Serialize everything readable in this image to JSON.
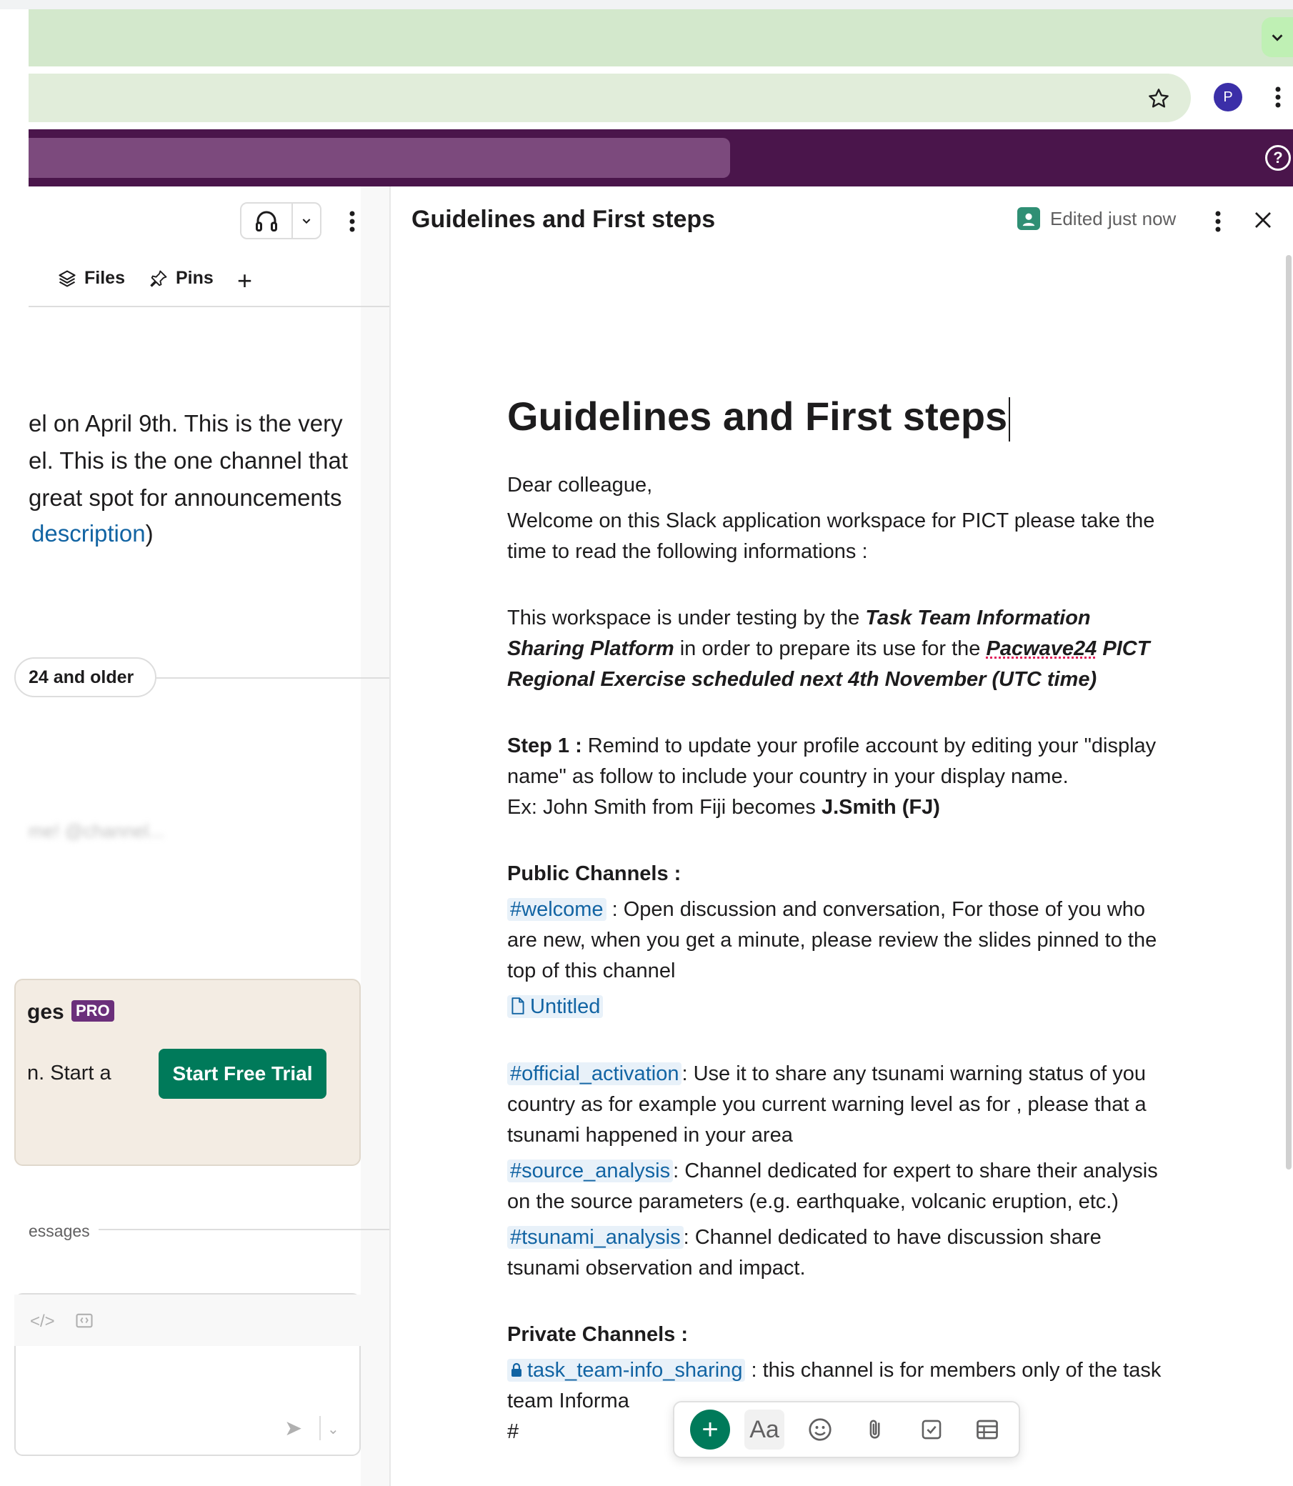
{
  "browser": {
    "profile_initial": "P"
  },
  "left": {
    "tabs": {
      "files": "Files",
      "pins": "Pins"
    },
    "intro_lines": [
      "el on April 9th. This is the very",
      "el. This is the one channel that",
      "great spot for announcements"
    ],
    "intro_link": "description",
    "intro_link_after": ")",
    "date_pill": "24 and older",
    "blurred_text": "me! @channel...",
    "upsell": {
      "title": "ges",
      "badge": "PRO",
      "text": "n. Start a",
      "button": "Start Free Trial"
    },
    "messages_divider": "essages"
  },
  "canvas": {
    "header_title": "Guidelines and First steps",
    "status": "Edited just now",
    "title": "Guidelines and First steps",
    "greeting": "Dear colleague,",
    "welcome": "Welcome on this Slack application workspace for PICT please take the time to read the following informations :",
    "testing_pre": "This workspace is under testing by the ",
    "testing_bold": "Task Team Information Sharing Platform",
    "testing_mid": " in order to prepare its use for the ",
    "testing_spell": "Pacwave24",
    "testing_bold2": " PICT Regional Exercise scheduled next 4th November (UTC time)",
    "step1_label": "Step 1 :",
    "step1_text": " Remind to update your profile account by editing your \"display name\" as follow to include your country in your display name.",
    "example_pre": "Ex: John Smith from Fiji becomes ",
    "example_bold": "J.Smith (FJ)",
    "public_heading": "Public Channels :",
    "welcome_channel": "#welcome",
    "welcome_desc": " : Open discussion and conversation, For those of you who are new, when you get a minute, please review the slides pinned to the top of this channel",
    "untitled": "Untitled",
    "official_channel": "#official_activation",
    "official_desc": ": Use it to share any tsunami warning status of you country as for example you current warning level as for , please that a tsunami happened in your area",
    "source_channel": "#source_analysis",
    "source_desc": ": Channel dedicated for expert to share their analysis on the source parameters (e.g. earthquake, volcanic eruption, etc.)",
    "tsunami_channel": "#tsunami_analysis",
    "tsunami_desc": ": Channel dedicated to have discussion share tsunami observation and impact.",
    "private_heading": "Private Channels :",
    "private_channel": "task_team-info_sharing",
    "private_desc": " : this channel is for members only of the task team Informa",
    "hash": "#",
    "toolbar_aa": "Aa"
  }
}
